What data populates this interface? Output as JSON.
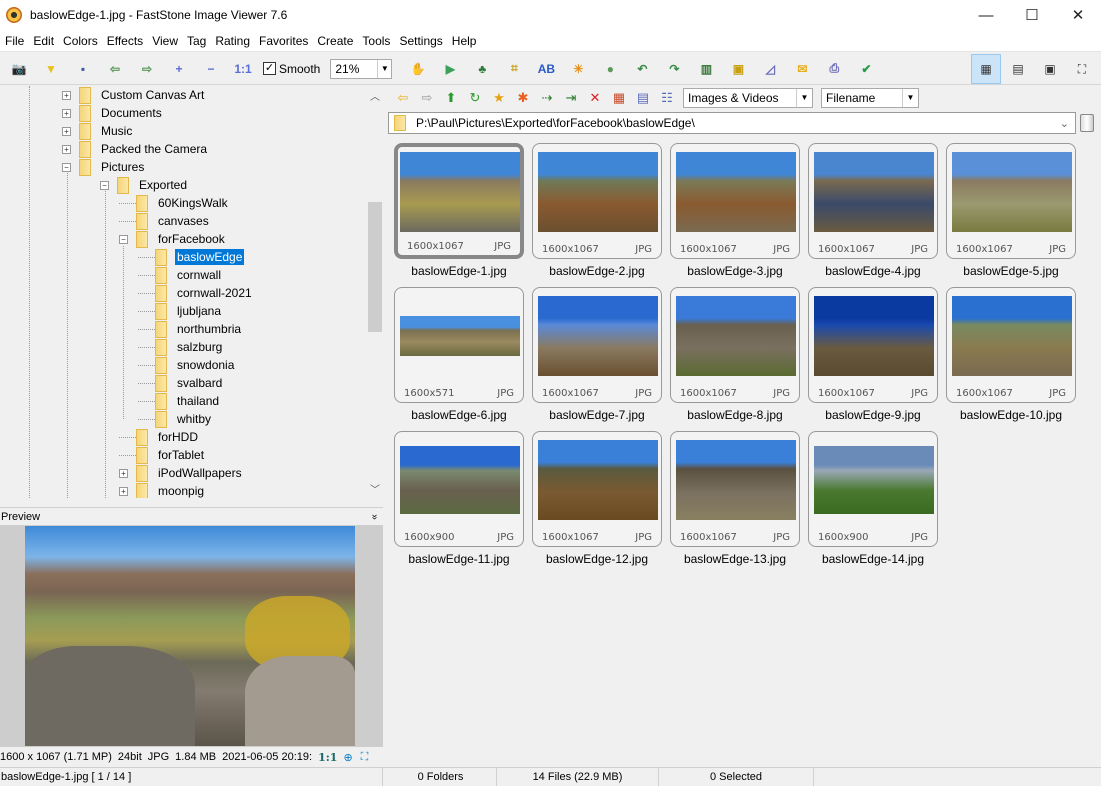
{
  "window": {
    "title": "baslowEdge-1.jpg  -  FastStone Image Viewer 7.6",
    "controls": {
      "minimize": "—",
      "maximize": "☐",
      "close": "✕"
    }
  },
  "menu": [
    "File",
    "Edit",
    "Colors",
    "Effects",
    "View",
    "Tag",
    "Rating",
    "Favorites",
    "Create",
    "Tools",
    "Settings",
    "Help"
  ],
  "toolbar": {
    "left_icons": [
      {
        "name": "acquire-camera-icon",
        "glyph": "📷",
        "color": "#555"
      },
      {
        "name": "open-folder-icon",
        "glyph": "▼",
        "color": "#e8c020"
      },
      {
        "name": "save-icon",
        "glyph": "▪",
        "color": "#3a57a8"
      },
      {
        "name": "previous-icon",
        "glyph": "⇦",
        "color": "#5a9a5a"
      },
      {
        "name": "next-icon",
        "glyph": "⇨",
        "color": "#5a9a5a"
      },
      {
        "name": "zoom-in-icon",
        "glyph": "+",
        "color": "#5a6ed8"
      },
      {
        "name": "zoom-out-icon",
        "glyph": "−",
        "color": "#5a6ed8"
      },
      {
        "name": "actual-size-icon",
        "glyph": "1:1",
        "color": "#5a6ed8"
      }
    ],
    "smooth_label": "Smooth",
    "smooth_checked": "✓",
    "zoom_value": "21%",
    "right_icons": [
      {
        "name": "hand-pan-icon",
        "glyph": "✋",
        "color": "#333"
      },
      {
        "name": "slideshow-icon",
        "glyph": "▶",
        "color": "#3aa05a"
      },
      {
        "name": "resize-icon",
        "glyph": "♣",
        "color": "#2a7a3a"
      },
      {
        "name": "crop-icon",
        "glyph": "⌗",
        "color": "#c8a010"
      },
      {
        "name": "text-icon",
        "glyph": "AB",
        "color": "#2a5ac8"
      },
      {
        "name": "brightness-icon",
        "glyph": "☀",
        "color": "#e8901a"
      },
      {
        "name": "set-wallpaper-icon",
        "glyph": "●",
        "color": "#5a9a5a"
      },
      {
        "name": "rotate-left-icon",
        "glyph": "↶",
        "color": "#3a8a4a"
      },
      {
        "name": "rotate-right-icon",
        "glyph": "↷",
        "color": "#3a8a4a"
      },
      {
        "name": "compare-icon",
        "glyph": "▥",
        "color": "#3a7a3a"
      },
      {
        "name": "windowed-icon",
        "glyph": "▣",
        "color": "#c8a010"
      },
      {
        "name": "scanner-icon",
        "glyph": "◿",
        "color": "#6a6ab8"
      },
      {
        "name": "email-icon",
        "glyph": "✉",
        "color": "#e8b020"
      },
      {
        "name": "print-icon",
        "glyph": "⎙",
        "color": "#6a6ab8"
      },
      {
        "name": "image-properties-icon",
        "glyph": "✔",
        "color": "#2a9a4a"
      }
    ],
    "view_modes": [
      {
        "name": "browser-view-icon",
        "glyph": "▦",
        "active": true
      },
      {
        "name": "thumbnails-view-icon",
        "glyph": "▤",
        "active": false
      },
      {
        "name": "filmstrip-view-icon",
        "glyph": "▣",
        "active": false
      },
      {
        "name": "fullscreen-icon",
        "glyph": "⛶",
        "active": false
      }
    ]
  },
  "tree": {
    "items": [
      {
        "label": "Custom Canvas Art",
        "depth": 0,
        "expander": "+"
      },
      {
        "label": "Documents",
        "depth": 0,
        "expander": "+"
      },
      {
        "label": "Music",
        "depth": 0,
        "expander": "+"
      },
      {
        "label": "Packed the Camera",
        "depth": 0,
        "expander": "+"
      },
      {
        "label": "Pictures",
        "depth": 0,
        "expander": "−"
      },
      {
        "label": "Exported",
        "depth": 1,
        "expander": "−"
      },
      {
        "label": "60KingsWalk",
        "depth": 2,
        "expander": ""
      },
      {
        "label": "canvases",
        "depth": 2,
        "expander": ""
      },
      {
        "label": "forFacebook",
        "depth": 2,
        "expander": "−"
      },
      {
        "label": "baslowEdge",
        "depth": 3,
        "expander": "",
        "selected": true
      },
      {
        "label": "cornwall",
        "depth": 3,
        "expander": ""
      },
      {
        "label": "cornwall-2021",
        "depth": 3,
        "expander": ""
      },
      {
        "label": "ljubljana",
        "depth": 3,
        "expander": ""
      },
      {
        "label": "northumbria",
        "depth": 3,
        "expander": ""
      },
      {
        "label": "salzburg",
        "depth": 3,
        "expander": ""
      },
      {
        "label": "snowdonia",
        "depth": 3,
        "expander": ""
      },
      {
        "label": "svalbard",
        "depth": 3,
        "expander": ""
      },
      {
        "label": "thailand",
        "depth": 3,
        "expander": ""
      },
      {
        "label": "whitby",
        "depth": 3,
        "expander": ""
      },
      {
        "label": "forHDD",
        "depth": 2,
        "expander": ""
      },
      {
        "label": "forTablet",
        "depth": 2,
        "expander": ""
      },
      {
        "label": "iPodWallpapers",
        "depth": 2,
        "expander": "+"
      },
      {
        "label": "moonpig",
        "depth": 2,
        "expander": "+"
      }
    ]
  },
  "preview": {
    "header": "Preview",
    "collapse_glyph": "»",
    "info": {
      "dimensions": "1600 x 1067 (1.71 MP)",
      "bitdepth": "24bit",
      "format": "JPG",
      "size": "1.84 MB",
      "datetime": "2021-06-05 20:19:",
      "ratio": "1:1"
    }
  },
  "nav": {
    "icons": [
      {
        "name": "back-icon",
        "glyph": "⇦",
        "color": "#e8b020"
      },
      {
        "name": "forward-icon",
        "glyph": "⇨",
        "color": "#999"
      },
      {
        "name": "up-folder-icon",
        "glyph": "⬆",
        "color": "#2a9a2a"
      },
      {
        "name": "refresh-folder-icon",
        "glyph": "↻",
        "color": "#2a9a2a"
      },
      {
        "name": "favorite-folder-icon",
        "glyph": "★",
        "color": "#e8a010"
      },
      {
        "name": "new-folder-icon",
        "glyph": "✱",
        "color": "#e86020"
      },
      {
        "name": "copy-to-icon",
        "glyph": "⇢",
        "color": "#2a7a2a"
      },
      {
        "name": "move-to-icon",
        "glyph": "⇥",
        "color": "#2a7a2a"
      },
      {
        "name": "delete-icon",
        "glyph": "✕",
        "color": "#e02020"
      },
      {
        "name": "thumbnail-size-icon",
        "glyph": "▦",
        "color": "#c84a2a"
      },
      {
        "name": "details-icon",
        "glyph": "▤",
        "color": "#5a6ab8"
      },
      {
        "name": "list-icon",
        "glyph": "☷",
        "color": "#5a6ab8"
      }
    ],
    "filter": "Images & Videos",
    "sort": "Filename",
    "path": "P:\\Paul\\Pictures\\Exported\\forFacebook\\baslowEdge\\"
  },
  "thumbnails": [
    {
      "name": "baslowEdge-1.jpg",
      "dims": "1600x1067",
      "type": "JPG",
      "aspect": "std",
      "selected": true,
      "palette": [
        "#3f86d6",
        "#8a7a60",
        "#a89a50",
        "#6c6a60"
      ]
    },
    {
      "name": "baslowEdge-2.jpg",
      "dims": "1600x1067",
      "type": "JPG",
      "aspect": "std",
      "palette": [
        "#3f86d6",
        "#6f7a58",
        "#8a5a30",
        "#6a5030"
      ]
    },
    {
      "name": "baslowEdge-3.jpg",
      "dims": "1600x1067",
      "type": "JPG",
      "aspect": "std",
      "palette": [
        "#3f86d6",
        "#7a7a58",
        "#8a5a30",
        "#7a6a50"
      ]
    },
    {
      "name": "baslowEdge-4.jpg",
      "dims": "1600x1067",
      "type": "JPG",
      "aspect": "std",
      "palette": [
        "#4a86d0",
        "#7a6a50",
        "#3a4a6a",
        "#6a5a40"
      ]
    },
    {
      "name": "baslowEdge-5.jpg",
      "dims": "1600x1067",
      "type": "JPG",
      "aspect": "std",
      "palette": [
        "#5a90d8",
        "#8a7a60",
        "#9a9a70",
        "#7a7a40"
      ]
    },
    {
      "name": "baslowEdge-6.jpg",
      "dims": "1600x571",
      "type": "JPG",
      "aspect": "pano",
      "palette": [
        "#4a90e0",
        "#7a7050",
        "#9a8a60",
        "#6a6a40"
      ]
    },
    {
      "name": "baslowEdge-7.jpg",
      "dims": "1600x1067",
      "type": "JPG",
      "aspect": "std",
      "palette": [
        "#2a6ad0",
        "#5a8ad8",
        "#8a7a60",
        "#6a5030"
      ]
    },
    {
      "name": "baslowEdge-8.jpg",
      "dims": "1600x1067",
      "type": "JPG",
      "aspect": "std",
      "palette": [
        "#3a7ad8",
        "#6a6050",
        "#7a7060",
        "#5a6a30"
      ]
    },
    {
      "name": "baslowEdge-9.jpg",
      "dims": "1600x1067",
      "type": "JPG",
      "aspect": "std",
      "palette": [
        "#0a3aa0",
        "#1a4ab0",
        "#6a5a40",
        "#5a4a30"
      ]
    },
    {
      "name": "baslowEdge-10.jpg",
      "dims": "1600x1067",
      "type": "JPG",
      "aspect": "std",
      "palette": [
        "#2a70d0",
        "#7a8a60",
        "#8a7a50",
        "#7a6a50"
      ]
    },
    {
      "name": "baslowEdge-11.jpg",
      "dims": "1600x900",
      "type": "JPG",
      "aspect": "wide",
      "palette": [
        "#2a6ad0",
        "#7a8a70",
        "#6a6050",
        "#5a6a40"
      ]
    },
    {
      "name": "baslowEdge-12.jpg",
      "dims": "1600x1067",
      "type": "JPG",
      "aspect": "std",
      "palette": [
        "#3a80d8",
        "#5a5a40",
        "#7a5a30",
        "#6a4a20"
      ]
    },
    {
      "name": "baslowEdge-13.jpg",
      "dims": "1600x1067",
      "type": "JPG",
      "aspect": "std",
      "palette": [
        "#3a80d8",
        "#5a5040",
        "#7a7060",
        "#8a8060"
      ]
    },
    {
      "name": "baslowEdge-14.jpg",
      "dims": "1600x900",
      "type": "JPG",
      "aspect": "wide",
      "palette": [
        "#6a8ab8",
        "#9aa8b8",
        "#4a7a30",
        "#3a6a20"
      ]
    }
  ],
  "status": {
    "current": "baslowEdge-1.jpg [ 1 / 14 ]",
    "folders": "0 Folders",
    "files": "14 Files (22.9 MB)",
    "selected": "0 Selected"
  }
}
